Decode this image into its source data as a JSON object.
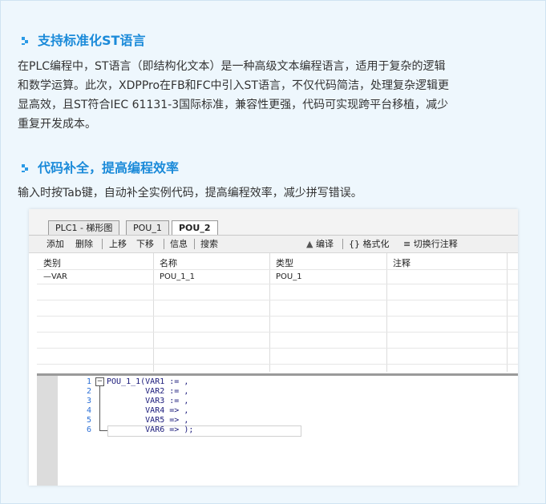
{
  "section1": {
    "title": "支持标准化ST语言",
    "lines": [
      "在PLC编程中，ST语言（即结构化文本）是一种高级文本编程语言，适用于复杂的逻辑",
      "和数学运算。此次，XDPPro在FB和FC中引入ST语言，不仅代码简洁，处理复杂逻辑更",
      "显高效，且ST符合IEC 61131-3国际标准，兼容性更强，代码可实现跨平台移植，减少",
      "重复开发成本。"
    ]
  },
  "section2": {
    "title": "代码补全，提高编程效率",
    "text": "输入时按Tab键，自动补全实例代码，提高编程效率，减少拼写错误。"
  },
  "editor": {
    "tabs": [
      "PLC1 - 梯形图",
      "POU_1",
      "POU_2"
    ],
    "toolbar": {
      "add": "添加",
      "delete": "删除",
      "up": "上移",
      "down": "下移",
      "info": "信息",
      "search": "搜索",
      "compile": "编译",
      "format": "格式化",
      "toggle_comment": "切换行注释"
    },
    "columns": [
      "类别",
      "名称",
      "类型",
      "注释"
    ],
    "row": {
      "category": "—VAR",
      "name": "POU_1_1",
      "type": "POU_1",
      "comment": ""
    },
    "code_lines": [
      {
        "num": "1",
        "text": "POU_1_1(VAR1 := ,"
      },
      {
        "num": "2",
        "text": "        VAR2 := ,"
      },
      {
        "num": "3",
        "text": "        VAR3 := ,"
      },
      {
        "num": "4",
        "text": "        VAR4 => ,"
      },
      {
        "num": "5",
        "text": "        VAR5 => ,"
      },
      {
        "num": "6",
        "text": "        VAR6 => );"
      }
    ]
  }
}
